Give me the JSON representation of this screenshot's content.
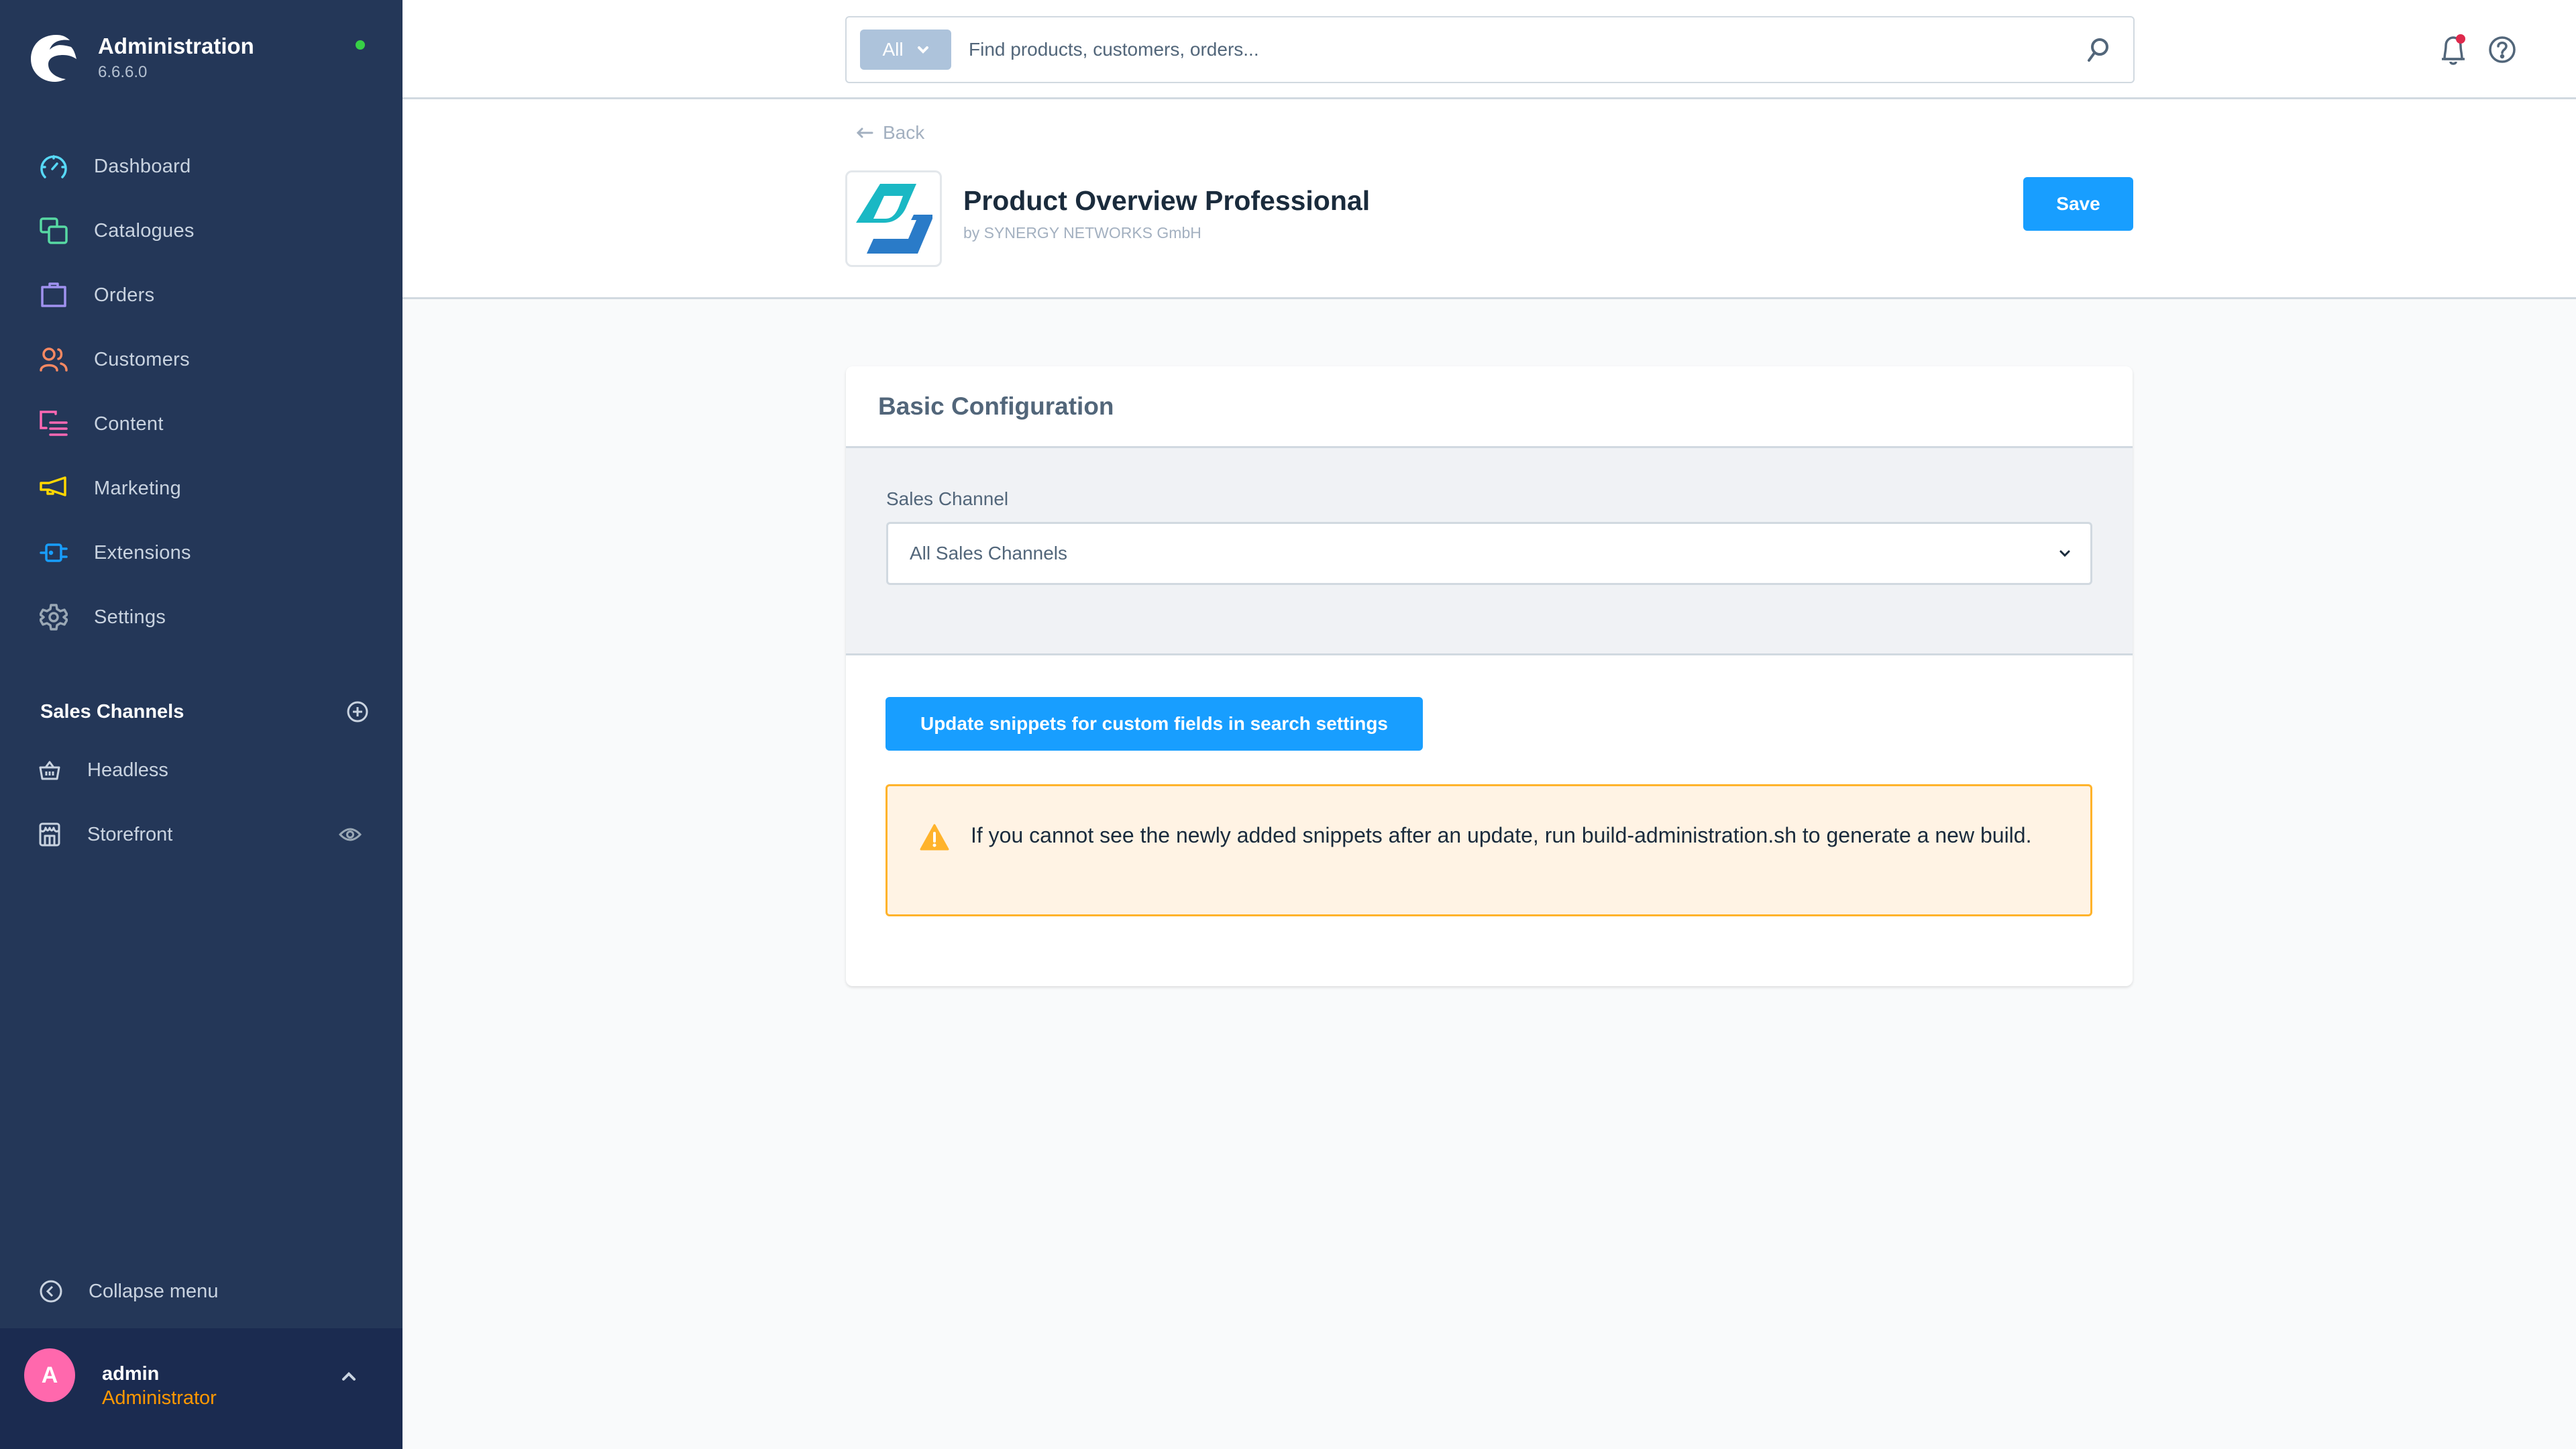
{
  "app": {
    "title": "Administration",
    "version": "6.6.6.0",
    "status": "online",
    "status_color": "#37d046"
  },
  "sidebar": {
    "items": [
      {
        "label": "Dashboard",
        "icon": "dashboard-icon",
        "color": "#57d9f8"
      },
      {
        "label": "Catalogues",
        "icon": "catalogues-icon",
        "color": "#57d9a3"
      },
      {
        "label": "Orders",
        "icon": "orders-icon",
        "color": "#a092f0"
      },
      {
        "label": "Customers",
        "icon": "customers-icon",
        "color": "#f88962"
      },
      {
        "label": "Content",
        "icon": "content-icon",
        "color": "#ff68b4"
      },
      {
        "label": "Marketing",
        "icon": "marketing-icon",
        "color": "#ffd700"
      },
      {
        "label": "Extensions",
        "icon": "extensions-icon",
        "color": "#189eff"
      },
      {
        "label": "Settings",
        "icon": "settings-icon",
        "color": "#9aa8b5"
      }
    ],
    "sales_channels": {
      "title": "Sales Channels",
      "items": [
        {
          "label": "Headless",
          "icon": "basket-icon"
        },
        {
          "label": "Storefront",
          "icon": "storefront-icon",
          "visibility_icon": "eye-icon"
        }
      ]
    },
    "collapse_label": "Collapse menu",
    "user": {
      "initial": "A",
      "name": "admin",
      "role": "Administrator",
      "avatar_color": "#ff68ad"
    }
  },
  "search": {
    "type_label": "All",
    "placeholder": "Find products, customers, orders...",
    "value": ""
  },
  "topbar": {
    "notification_badge": true
  },
  "page": {
    "back_label": "Back",
    "plugin_name": "Product Overview Professional",
    "vendor": "by SYNERGY NETWORKS GmbH",
    "save_label": "Save"
  },
  "card": {
    "title": "Basic Configuration",
    "sales_channel_label": "Sales Channel",
    "sales_channel_value": "All Sales Channels",
    "update_button_label": "Update snippets for custom fields in search settings",
    "alert_text": "If you cannot see the newly added snippets after an update, run build-administration.sh to generate a new build.",
    "alert_variant": "warning"
  },
  "colors": {
    "sidebar_bg": "#243758",
    "primary": "#189eff",
    "warning": "#ffb32b"
  }
}
